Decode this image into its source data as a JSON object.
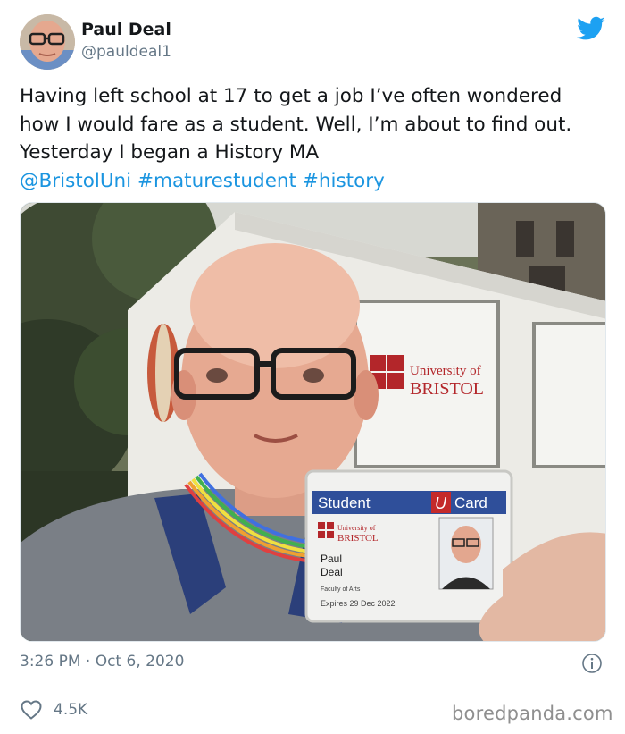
{
  "author": {
    "name": "Paul Deal",
    "handle": "@pauldeal1"
  },
  "tweet": {
    "text_plain": "Having left school at 17 to get a job I’ve often wondered how I would fare as a student. Well, I’m about to find out. Yesterday I began a History MA",
    "mention": "@BristolUni",
    "hashtag_1": "#maturestudent",
    "hashtag_2": "#history"
  },
  "photo": {
    "sign_line_1": "University of",
    "sign_line_2": "BRISTOL",
    "card": {
      "header_left": "Student",
      "header_u": "U",
      "header_right": "Card",
      "logo_line_1": "University of",
      "logo_line_2": "BRISTOL",
      "first_name": "Paul",
      "last_name": "Deal",
      "faculty": "Faculty of Arts",
      "expires": "Expires 29 Dec 2022"
    }
  },
  "meta": {
    "timestamp": "3:26 PM · Oct 6, 2020",
    "likes": "4.5K"
  },
  "watermark": "boredpanda.com",
  "icons": {
    "logo": "twitter-bird-icon",
    "info": "info-icon",
    "like": "heart-icon"
  },
  "colors": {
    "link": "#1b95e0",
    "twitter_blue": "#1da1f2",
    "secondary_text": "#657786"
  }
}
